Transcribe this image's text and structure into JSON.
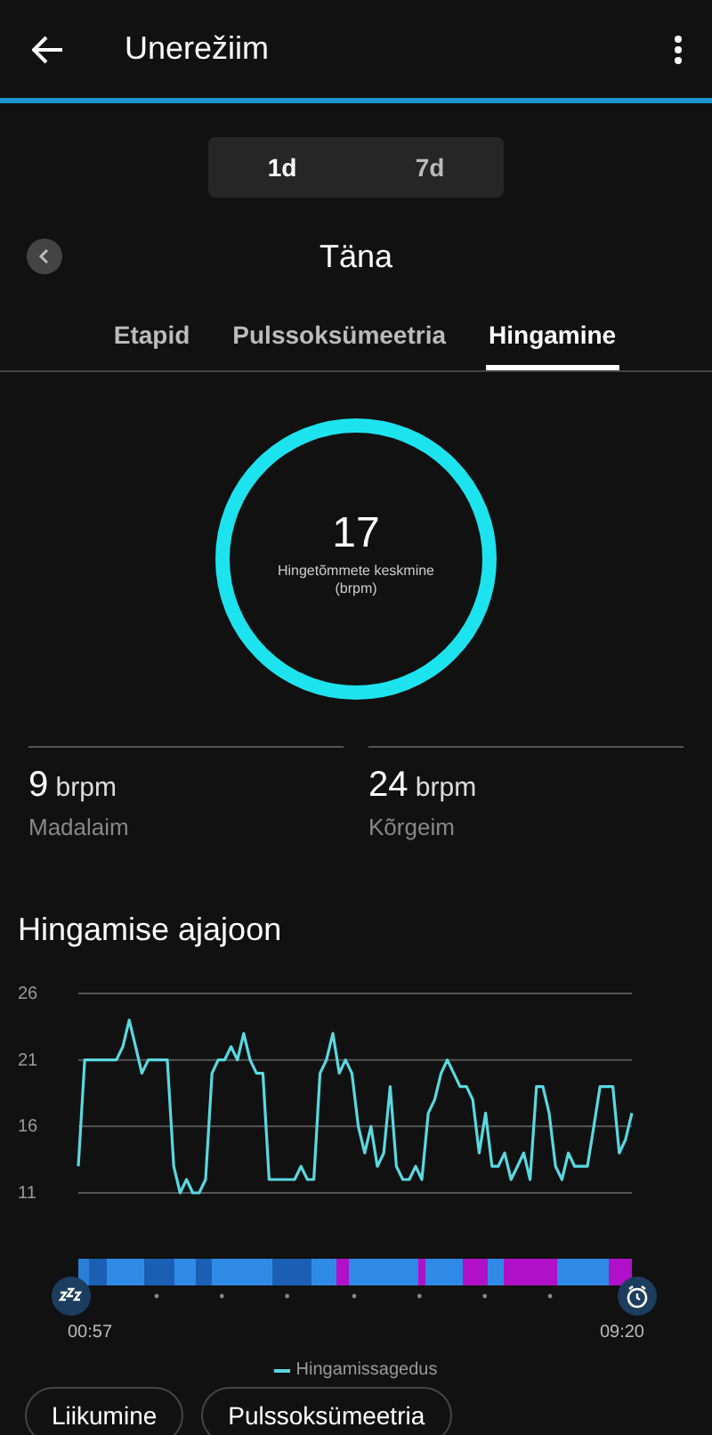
{
  "app_bar": {
    "title": "Unerežiim"
  },
  "range_toggle": [
    {
      "label": "1d",
      "selected": true
    },
    {
      "label": "7d",
      "selected": false
    }
  ],
  "date_nav": {
    "label": "Täna"
  },
  "tabs": [
    {
      "label": "Etapid",
      "selected": false
    },
    {
      "label": "Pulssoksümeetria",
      "selected": false
    },
    {
      "label": "Hingamine",
      "selected": true
    }
  ],
  "average": {
    "value": "17",
    "label": "Hingetõmmete keskmine",
    "unit": "(brpm)"
  },
  "stats": [
    {
      "value": "9",
      "unit": "brpm",
      "label": "Madalaim"
    },
    {
      "value": "24",
      "unit": "brpm",
      "label": "Kõrgeim"
    }
  ],
  "timeline": {
    "title": "Hingamise ajajoon",
    "start_time": "00:57",
    "end_time": "09:20",
    "chart_data": {
      "type": "line",
      "grid": true,
      "ylim": [
        11,
        26
      ],
      "yticks": [
        11,
        16,
        21,
        26
      ],
      "series": [
        {
          "name": "Hingamissagedus",
          "color": "#5ad8e0",
          "values": [
            13,
            21,
            21,
            21,
            21,
            21,
            21,
            22,
            24,
            22,
            20,
            21,
            21,
            21,
            21,
            13,
            11,
            12,
            11,
            11,
            12,
            20,
            21,
            21,
            22,
            21,
            23,
            21,
            20,
            20,
            12,
            12,
            12,
            12,
            12,
            13,
            12,
            12,
            20,
            21,
            23,
            20,
            21,
            20,
            16,
            14,
            16,
            13,
            14,
            19,
            13,
            12,
            12,
            13,
            12,
            17,
            18,
            20,
            21,
            20,
            19,
            19,
            18,
            14,
            17,
            13,
            13,
            14,
            12,
            13,
            14,
            12,
            19,
            19,
            17,
            13,
            12,
            14,
            13,
            13,
            13,
            16,
            19,
            19,
            19,
            14,
            15,
            17
          ]
        }
      ]
    }
  },
  "chips": [
    {
      "label": "Liikumine"
    },
    {
      "label": "Pulssoksümeetria"
    }
  ]
}
